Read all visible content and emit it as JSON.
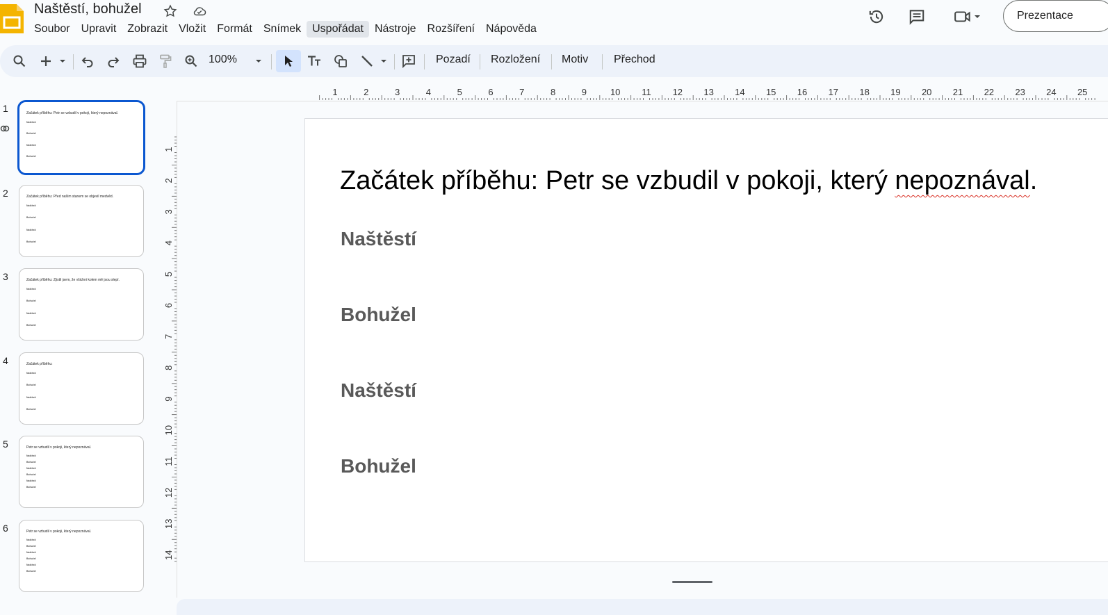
{
  "app": {
    "doc_title": "Naštěstí, bohužel",
    "present_label": "Prezentace"
  },
  "menu": [
    "Soubor",
    "Upravit",
    "Zobrazit",
    "Vložit",
    "Formát",
    "Snímek",
    "Uspořádat",
    "Nástroje",
    "Rozšíření",
    "Nápověda"
  ],
  "menu_active": "Uspořádat",
  "toolbar": {
    "zoom": "100%",
    "background_label": "Pozadí",
    "layout_label": "Rozložení",
    "theme_label": "Motiv",
    "transition_label": "Přechod"
  },
  "slides": [
    {
      "num": "1",
      "title": "Začátek příběhu: Petr se vzbudil v pokoji, který nepoznával.",
      "lines": [
        "Naštěstí",
        "Bohužel",
        "Naštěstí",
        "Bohužel"
      ]
    },
    {
      "num": "2",
      "title": "Začátek příběhu: Před naším stanem se objevil medvěd.",
      "lines": [
        "Naštěstí",
        "Bohužel",
        "Naštěstí",
        "Bohužel"
      ]
    },
    {
      "num": "3",
      "title": "Začátek příběhu: Zjistil jsem, že všichni kolem mě jsou slepí.",
      "lines": [
        "Naštěstí",
        "Bohužel",
        "Naštěstí",
        "Bohužel"
      ]
    },
    {
      "num": "4",
      "title": "Začátek příběhu:",
      "lines": [
        "Naštěstí",
        "Bohužel",
        "Naštěstí",
        "Bohužel"
      ]
    },
    {
      "num": "5",
      "title": "Petr se vzbudil v pokoji, který nepoznával.",
      "lines": [
        "Naštěstí",
        "Bohužel",
        "Naštěstí",
        "Bohužel",
        "Naštěstí",
        "Bohužel"
      ]
    },
    {
      "num": "6",
      "title": "Petr se vzbudil v pokoji, který nepoznával.",
      "lines": [
        "Naštěstí",
        "Bohužel",
        "Naštěstí",
        "Bohužel",
        "Naštěstí",
        "Bohužel"
      ]
    }
  ],
  "current_slide": {
    "title_prefix": "Začátek příběhu: Petr se vzbudil v pokoji, který ",
    "title_misspelled": "nepoznával",
    "title_suffix": ".",
    "body": [
      "Naštěstí",
      "Bohužel",
      "Naštěstí",
      "Bohužel"
    ]
  },
  "ruler": {
    "top_labels": [
      "1",
      "2",
      "3",
      "4",
      "5",
      "6",
      "7",
      "8",
      "9",
      "10",
      "11",
      "12",
      "13",
      "14",
      "15",
      "16",
      "17",
      "18",
      "19",
      "20",
      "21",
      "22",
      "23",
      "24",
      "25"
    ],
    "left_labels": [
      "1",
      "2",
      "3",
      "4",
      "5",
      "6",
      "7",
      "8",
      "9",
      "10",
      "11",
      "12",
      "13",
      "14"
    ]
  },
  "colors": {
    "accent": "#0b57d0",
    "logo": "#f4b400",
    "toolbar_bg": "#edf2fa"
  }
}
